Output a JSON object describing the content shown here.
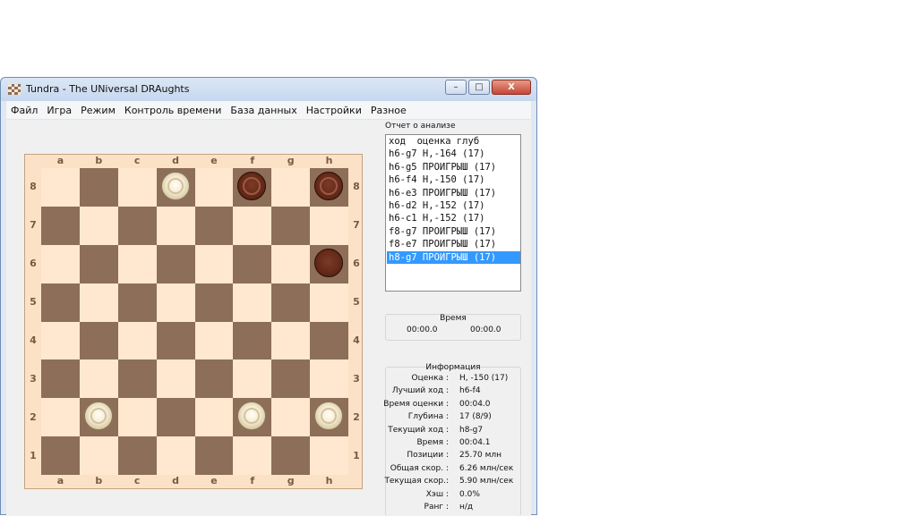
{
  "window": {
    "title": "Tundra - The UNiversal DRAughts",
    "buttons": {
      "minimize": "–",
      "maximize": "□",
      "close": "X"
    }
  },
  "menu": [
    "Файл",
    "Игра",
    "Режим",
    "Контроль времени",
    "База данных",
    "Настройки",
    "Разное"
  ],
  "board": {
    "files": [
      "a",
      "b",
      "c",
      "d",
      "e",
      "f",
      "g",
      "h"
    ],
    "ranks": [
      "8",
      "7",
      "6",
      "5",
      "4",
      "3",
      "2",
      "1"
    ],
    "pieces": [
      {
        "square": "d8",
        "color": "white"
      },
      {
        "square": "f8",
        "color": "black",
        "ringed": true
      },
      {
        "square": "h8",
        "color": "black",
        "ringed": true
      },
      {
        "square": "h6",
        "color": "black",
        "ringed": false
      },
      {
        "square": "b2",
        "color": "white"
      },
      {
        "square": "f2",
        "color": "white"
      },
      {
        "square": "h2",
        "color": "white"
      }
    ],
    "colors": {
      "dark": "#8d6e58",
      "light": "#ffe8cf"
    }
  },
  "analysis": {
    "label": "Отчет о анализе",
    "rows": [
      "ход  оценка глуб",
      "h6-g7 Н,-164 (17)",
      "h6-g5 ПРОИГРЫШ (17)",
      "h6-f4 Н,-150 (17)",
      "h6-e3 ПРОИГРЫШ (17)",
      "h6-d2 Н,-152 (17)",
      "h6-c1 Н,-152 (17)",
      "f8-g7 ПРОИГРЫШ (17)",
      "f8-e7 ПРОИГРЫШ (17)",
      "h8-g7 ПРОИГРЫШ (17)"
    ],
    "selected_index": 9,
    "selected_color": "#3399ff"
  },
  "time": {
    "title": "Время",
    "left": "00:00.0",
    "right": "00:00.0"
  },
  "info": {
    "title": "Информация",
    "rows": [
      {
        "key": "Оценка :",
        "value": "Н, -150 (17)"
      },
      {
        "key": "Лучший ход :",
        "value": "h6-f4"
      },
      {
        "key": "Время оценки :",
        "value": "00:04.0"
      },
      {
        "key": "Глубина :",
        "value": "17 (8/9)"
      },
      {
        "key": "Текущий ход :",
        "value": "h8-g7"
      },
      {
        "key": "Время :",
        "value": "00:04.1"
      },
      {
        "key": "Позиции :",
        "value": "25.70 млн"
      },
      {
        "key": "Общая скор. :",
        "value": "6.26 млн/сек"
      },
      {
        "key": "Текущая скор.:",
        "value": "5.90 млн/сек"
      },
      {
        "key": "Хэш :",
        "value": "0.0%"
      },
      {
        "key": "Ранг :",
        "value": "н/д"
      }
    ]
  }
}
